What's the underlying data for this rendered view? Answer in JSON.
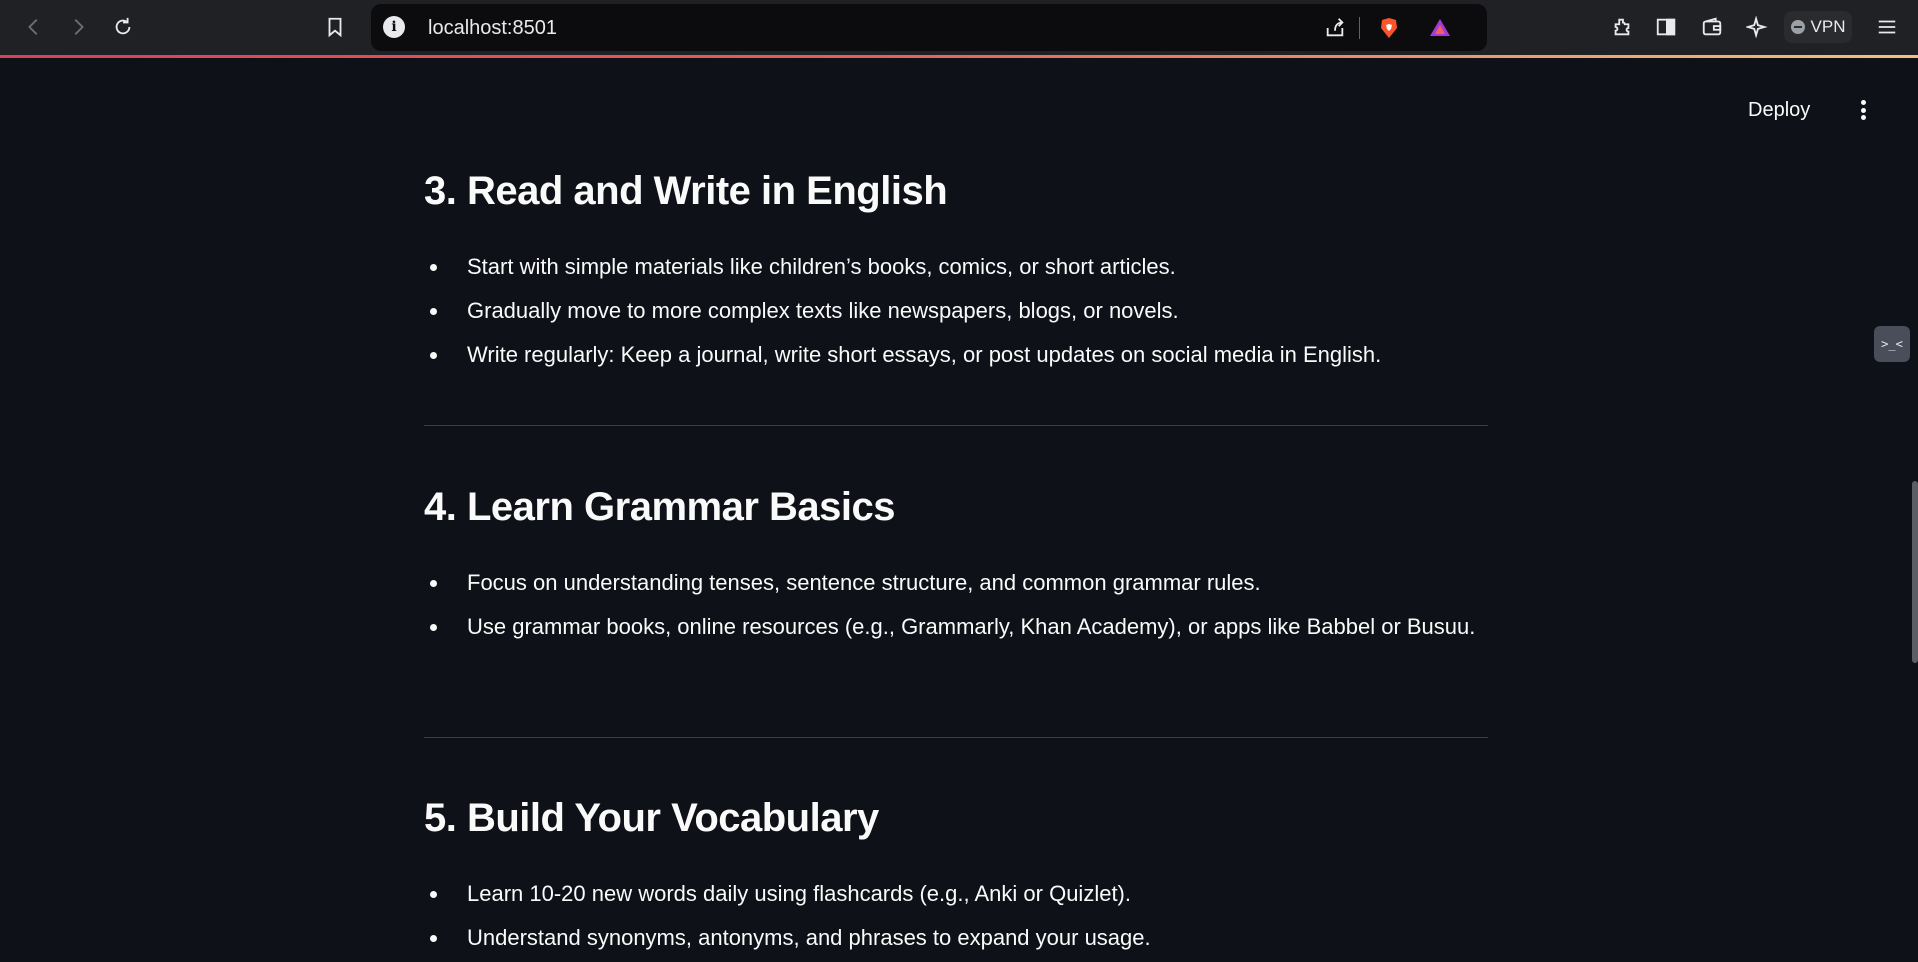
{
  "browser": {
    "url": "localhost:8501",
    "vpn_label": "VPN"
  },
  "app": {
    "deploy_label": "Deploy"
  },
  "sections": [
    {
      "title": "3. Read and Write in English",
      "items": [
        "Start with simple materials like children’s books, comics, or short articles.",
        "Gradually move to more complex texts like newspapers, blogs, or novels.",
        "Write regularly: Keep a journal, write short essays, or post updates on social media in English."
      ]
    },
    {
      "title": "4. Learn Grammar Basics",
      "items": [
        "Focus on understanding tenses, sentence structure, and common grammar rules.",
        "Use grammar books, online resources (e.g., Grammarly, Khan Academy), or apps like Babbel or Busuu."
      ]
    },
    {
      "title": "5. Build Your Vocabulary",
      "items": [
        "Learn 10-20 new words daily using flashcards (e.g., Anki or Quizlet).",
        "Understand synonyms, antonyms, and phrases to expand your usage."
      ]
    }
  ]
}
